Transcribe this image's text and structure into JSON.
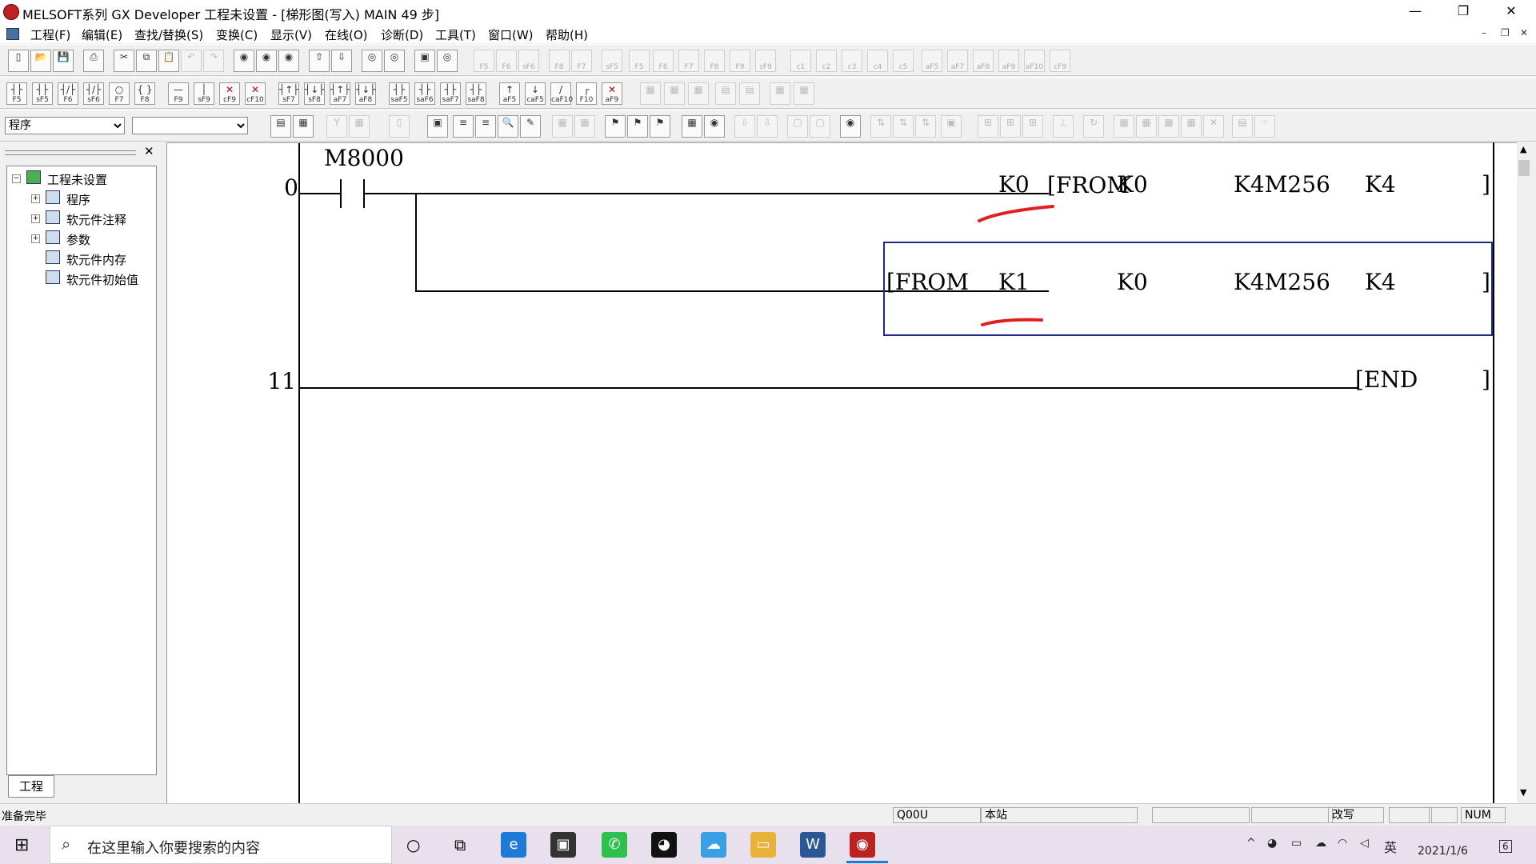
{
  "window": {
    "title": "MELSOFT系列 GX Developer 工程未设置 - [梯形图(写入)    MAIN    49 步]",
    "minimize": "—",
    "restore": "❐",
    "close": "✕"
  },
  "menu": [
    "工程(F)",
    "编辑(E)",
    "查找/替换(S)",
    "变换(C)",
    "显示(V)",
    "在线(O)",
    "诊断(D)",
    "工具(T)",
    "窗口(W)",
    "帮助(H)"
  ],
  "mdi": {
    "minimize": "–",
    "restore": "❐",
    "close": "✕"
  },
  "toolbar_ladder_keys": [
    "F5",
    "sF5",
    "F6",
    "sF6",
    "F7",
    "F8",
    "F9",
    "sF9",
    "cF9",
    "cF10",
    "sF7",
    "sF8",
    "aF7",
    "aF8",
    "saF5",
    "saF6",
    "saF7",
    "saF8",
    "aF5",
    "caF5",
    "caF10",
    "F10",
    "aF9"
  ],
  "toolbar_top_disabled_keys": [
    "F5",
    "F6",
    "sF6",
    "F8",
    "F7",
    "sF5",
    "F5",
    "F6",
    "F7",
    "F8",
    "F9",
    "sF9",
    "c1",
    "c2",
    "c3",
    "c4",
    "c5",
    "aF5",
    "aF7",
    "aF8",
    "aF9",
    "aF10",
    "cF9"
  ],
  "data_type_combo": "程序",
  "sub_combo": "",
  "project_tree": {
    "root": "工程未设置",
    "items": [
      "程序",
      "软元件注释",
      "参数",
      "软元件内存",
      "软元件初始值"
    ],
    "tab": "工程"
  },
  "ladder": {
    "rungs": [
      {
        "step": "0",
        "contact": "M8000",
        "instructions": [
          {
            "op": "[FROM",
            "args": [
              "K0",
              "K0",
              "K4M256",
              "K4"
            ]
          },
          {
            "op": "[FROM",
            "args": [
              "K1",
              "K0",
              "K4M256",
              "K4"
            ]
          }
        ]
      },
      {
        "step": "11",
        "instructions": [
          {
            "op": "[END",
            "args": []
          }
        ]
      }
    ],
    "bracket_close": "]"
  },
  "status": {
    "left": "准备完毕",
    "cpu": "Q00U",
    "station": "本站",
    "mode": "改写",
    "num": "NUM"
  },
  "taskbar": {
    "search_placeholder": "在这里输入你要搜索的内容",
    "lang": "英",
    "time": "",
    "date": "2021/1/6",
    "notif_count": "6"
  },
  "colors": {
    "selection": "#1e2a8a",
    "annotation": "#e02020"
  }
}
